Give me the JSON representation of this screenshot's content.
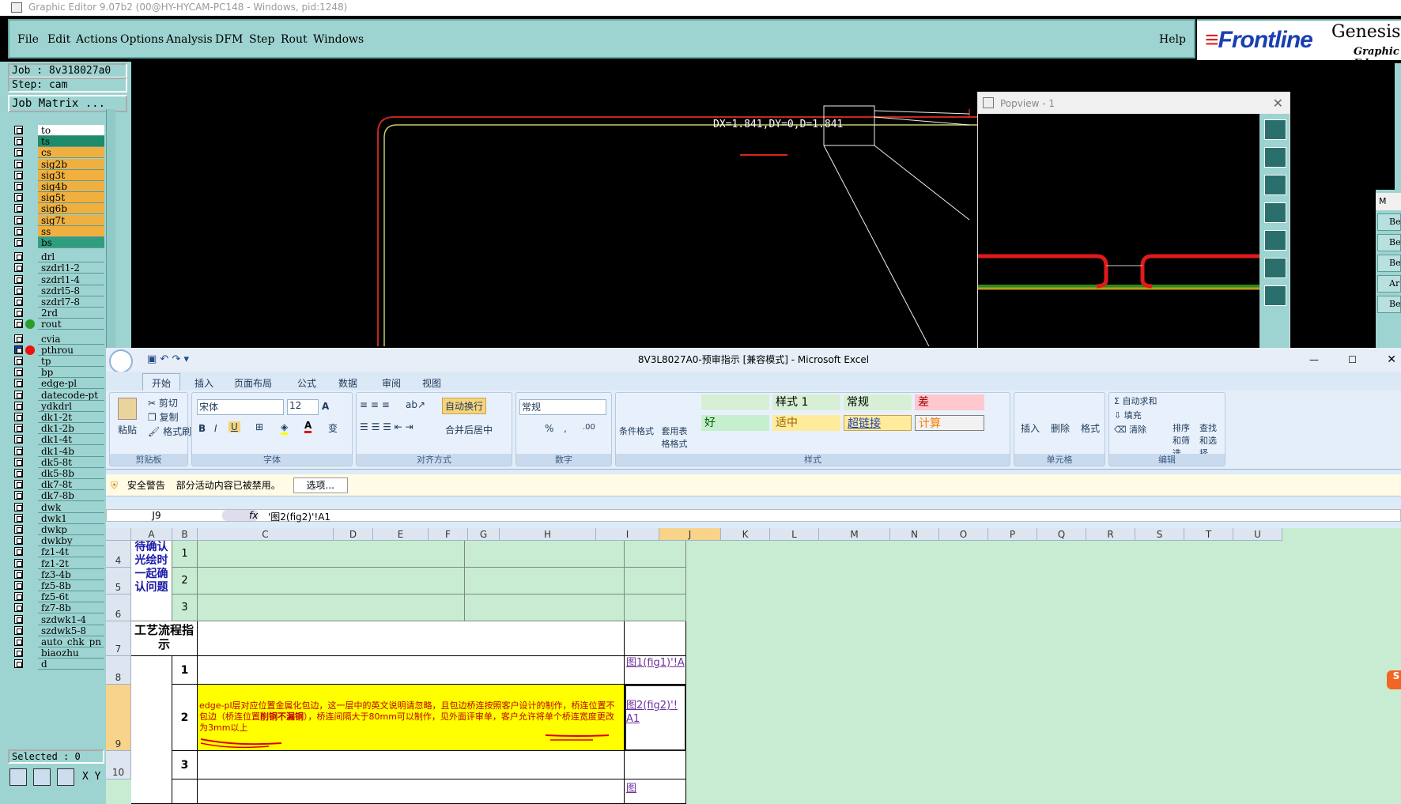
{
  "genesis": {
    "window_title": "Graphic Editor 9.07b2 (00@HY-HYCAM-PC148 - Windows, pid:1248)",
    "menu": [
      "File",
      "Edit",
      "Actions",
      "Options",
      "Analysis",
      "DFM",
      "Step",
      "Rout",
      "Windows"
    ],
    "help": "Help",
    "brand": {
      "front": "Frontline",
      "genesis": "Genesis",
      "subtitle": "Graphic Ed"
    },
    "job": "Job : 8v318027a0",
    "step": "Step: cam",
    "job_matrix": "Job Matrix ...",
    "layers": [
      "to",
      "ts",
      "cs",
      "sig2b",
      "sig3t",
      "sig4b",
      "sig5t",
      "sig6b",
      "sig7t",
      "ss",
      "bs",
      "drl",
      "szdrl1-2",
      "szdrl1-4",
      "szdrl5-8",
      "szdrl7-8",
      "2rd",
      "rout",
      "cvia",
      "pthrou",
      "tp",
      "bp",
      "edge-pl",
      "datecode-pt",
      "ydkdrl",
      "dk1-2t",
      "dk1-2b",
      "dk1-4t",
      "dk1-4b",
      "dk5-8t",
      "dk5-8b",
      "dk7-8t",
      "dk7-8b",
      "dwk",
      "dwk1",
      "dwkp",
      "dwkby",
      "fz1-4t",
      "fz1-2t",
      "fz3-4b",
      "fz5-8b",
      "fz5-6t",
      "fz7-8b",
      "szdwk1-4",
      "szdwk5-8",
      "auto_chk_pn",
      "biaozhu",
      "d"
    ],
    "selected": "Selected : 0",
    "measure": "DX=1.841,DY=0,D=1.841",
    "popview_title": "Popview - 1",
    "xy_label": "X Y",
    "right_stub": [
      "M",
      "Be",
      "Be",
      "Be",
      "Ar",
      "Be"
    ]
  },
  "excel": {
    "title": "8V3L8027A0-预审指示 [兼容模式] - Microsoft Excel",
    "tabs": [
      "开始",
      "插入",
      "页面布局",
      "公式",
      "数据",
      "审阅",
      "视图"
    ],
    "clipboard": {
      "paste": "粘贴",
      "cut": "剪切",
      "copy": "复制",
      "format_painter": "格式刷",
      "label": "剪贴板"
    },
    "font": {
      "name": "宋体",
      "size": "12",
      "label": "字体",
      "bold": "B",
      "italic": "I",
      "underline": "U",
      "grow": "A",
      "fontcolor": "A",
      "wen": "变"
    },
    "align": {
      "wrap": "自动换行",
      "merge": "合并后居中",
      "label": "对齐方式"
    },
    "number": {
      "format": "常规",
      "percent": "%",
      "comma": ",",
      "inc": ".00",
      "label": "数字"
    },
    "styles": {
      "cond": "条件格式",
      "table": "套用表格格式",
      "cells": [
        "样式 1",
        "常规",
        "差",
        "好",
        "适中",
        "超链接",
        "计算"
      ],
      "label": "样式"
    },
    "cells_grp": {
      "insert": "插入",
      "delete": "删除",
      "format": "格式",
      "label": "单元格"
    },
    "editing": {
      "autosum": "自动求和",
      "fill": "填充",
      "clear": "清除",
      "sort": "排序和筛选",
      "find": "查找和选择",
      "label": "编辑"
    },
    "security": {
      "title": "安全警告",
      "msg": "部分活动内容已被禁用。",
      "button": "选项..."
    },
    "namebox": "J9",
    "fx": "fx",
    "formula": "'图2(fig2)'!A1",
    "columns": [
      "A",
      "B",
      "C",
      "D",
      "E",
      "F",
      "G",
      "H",
      "I",
      "J",
      "K",
      "L",
      "M",
      "N",
      "O",
      "P",
      "Q",
      "R",
      "S",
      "T",
      "U"
    ],
    "rows": [
      "4",
      "5",
      "6",
      "7",
      "8",
      "9",
      "10"
    ],
    "a_confirm": "待确认光绘时一起确认问题",
    "b_nums": [
      "1",
      "2",
      "3"
    ],
    "process_label": "工艺流程指示",
    "b8": "1",
    "b9": "2",
    "b10": "3",
    "c9_pre": "edge-pl层对应位置金属化包边，这一层中的英文说明请忽略，且包边桥连按照客户设计的制作，桥连位置不包边（桥连位置",
    "c9_bold": "削铜不漏铜",
    "c9_post": "），桥连间隔大于80mm可以制作，见外面评审单，客户允许将单个桥连宽度更改为3mm以上",
    "j8": "图1(fig1)'!A",
    "j9": "图2(fig2)'!A1",
    "j10": "图"
  }
}
